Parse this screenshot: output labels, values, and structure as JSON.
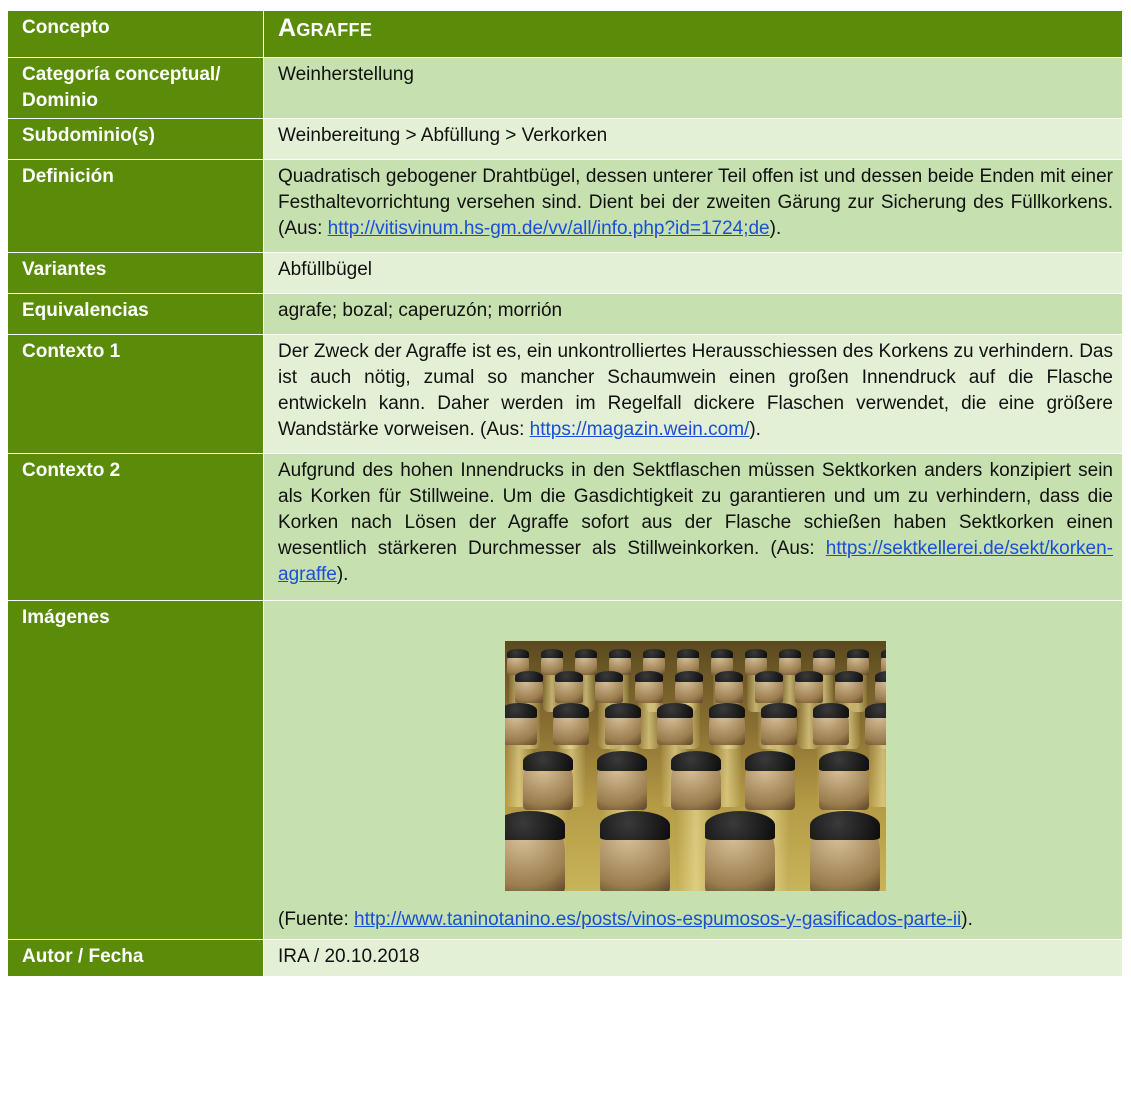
{
  "header": {
    "label": "Concepto",
    "value": "Agraffe"
  },
  "rows": {
    "categoria": {
      "label": "Categoría conceptual/ Dominio",
      "value": "Weinherstellung"
    },
    "subdominio": {
      "label": "Subdominio(s)",
      "value": "Weinbereitung > Abfüllung > Verkorken"
    },
    "definicion": {
      "label": "Definición",
      "text": "Quadratisch gebogener Drahtbügel, dessen unterer Teil offen ist und dessen beide Enden mit einer Festhaltevorrichtung versehen sind. Dient bei der zweiten Gärung zur Sicherung des Füllkorkens. (Aus: ",
      "link": "http://vitisvinum.hs-gm.de/vv/all/info.php?id=1724;de",
      "tail": ")."
    },
    "variantes": {
      "label": "Variantes",
      "value": "Abfüllbügel"
    },
    "equivalencias": {
      "label": "Equivalencias",
      "value": "agrafe; bozal; caperuzón; morrión"
    },
    "contexto1": {
      "label": "Contexto 1",
      "text": "Der Zweck der Agraffe ist es, ein unkontrolliertes Herausschiessen des Korkens zu verhindern. Das ist auch nötig, zumal so mancher Schaumwein einen großen Innendruck auf die Flasche entwickeln kann. Daher werden im Regelfall dickere Flaschen verwendet, die eine größere Wandstärke vorweisen. (Aus: ",
      "link": "https://magazin.wein.com/",
      "tail": ")."
    },
    "contexto2": {
      "label": "Contexto 2",
      "text": "Aufgrund des hohen Innendrucks in den Sektflaschen müssen Sektkorken anders konzipiert sein als Korken für Stillweine. Um die Gasdichtigkeit zu garantieren und um zu verhindern, dass die Korken nach Lösen der Agraffe sofort aus der Flasche schießen haben Sektkorken einen wesentlich stärkeren Durchmesser als Stillweinkorken. (Aus: ",
      "link": "https://sektkellerei.de/sekt/korken-agraffe",
      "tail": ")."
    },
    "imagenes": {
      "label": "Imágenes",
      "caption_prefix": "(Fuente: ",
      "link": "http://www.taninotanino.es/posts/vinos-espumosos-y-gasificados-parte-ii",
      "tail": ")."
    },
    "autor": {
      "label": "Autor / Fecha",
      "value": "IRA / 20.10.2018"
    }
  }
}
